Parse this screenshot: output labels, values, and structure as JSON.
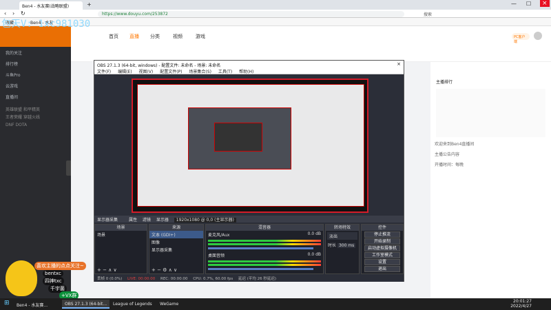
{
  "watermark": "包天V: 1xc981030",
  "browser": {
    "tab_title": "Ben4 - 水友赛(战略联盟)",
    "url": "https://www.douyu.com/253872",
    "bookmarks": [
      "收藏",
      "Ben4 - 水友"
    ],
    "search_placeholder": "搜索"
  },
  "douyu": {
    "nav": [
      "首页",
      "直播",
      "分类",
      "视频",
      "游戏"
    ],
    "side_items": [
      "我的关注",
      "排行榜",
      "斗鱼Pro",
      "云游戏",
      "直播间"
    ],
    "live_sections": [
      "英雄联盟",
      "和平精英",
      "王者荣耀",
      "穿越火线",
      "DNF",
      "DOTA"
    ],
    "right_panel": {
      "header": "主播排行",
      "chat": [
        "欢迎来到Ben4直播间",
        "主播公告内容",
        "开播时间：每晚"
      ],
      "pc_button": "PC客户端"
    }
  },
  "obs": {
    "title": "OBS 27.1.3 (64-bit, windows) - 配置文件: 未命名 - 场景: 未命名",
    "menu": [
      "文件(F)",
      "编辑(E)",
      "视图(V)",
      "配置文件(P)",
      "场景集合(S)",
      "工具(T)",
      "帮助(H)"
    ],
    "toolbar": [
      "显示器采集",
      "属性",
      "滤镜",
      "显示器",
      "1920x1080 @ 0,0 (主显示器)"
    ],
    "docks": {
      "scenes": {
        "title": "场景",
        "items": [
          "场景"
        ]
      },
      "sources": {
        "title": "来源",
        "items": [
          "文本 (GDI+)",
          "图像",
          "显示器采集"
        ]
      },
      "mixer": {
        "title": "混音器",
        "channels": [
          {
            "name": "麦克风/Aux",
            "db": "0.0 dB"
          },
          {
            "name": "桌面音频",
            "db": "0.0 dB"
          }
        ]
      },
      "transitions": {
        "title": "转场特效",
        "type": "淡出",
        "duration_label": "时长",
        "duration": "300 ms"
      },
      "controls": {
        "title": "控件",
        "buttons": [
          "停止推流",
          "开始录制",
          "启动虚拟摄像机",
          "工作室模式",
          "设置",
          "退出"
        ]
      }
    },
    "status": {
      "dropped": "丢帧 0 (0.0%)",
      "live": "LIVE: 00:00:00",
      "rec": "REC: 00:00:00",
      "cpu": "CPU: 0.7%, 60.00 fps",
      "delay": "延迟 (平均 26 秒延迟)"
    }
  },
  "overlay": {
    "line1": "喜欢主播的点点关注~",
    "line2": "bentxc",
    "line3": "四神txc",
    "line4": "千宇菌",
    "line5": "+VX群"
  },
  "taskbar": {
    "items": [
      "Ben4 - 水友赛...",
      "OBS 27.1.3 (64-bit...",
      "League of Legends",
      "WeGame"
    ],
    "time": "20:01:27",
    "date": "2022/4/27"
  },
  "colors": {
    "obs_red": "#d61b28",
    "douyu_orange": "#ff7700",
    "taskbar": "#1f1f1f"
  }
}
